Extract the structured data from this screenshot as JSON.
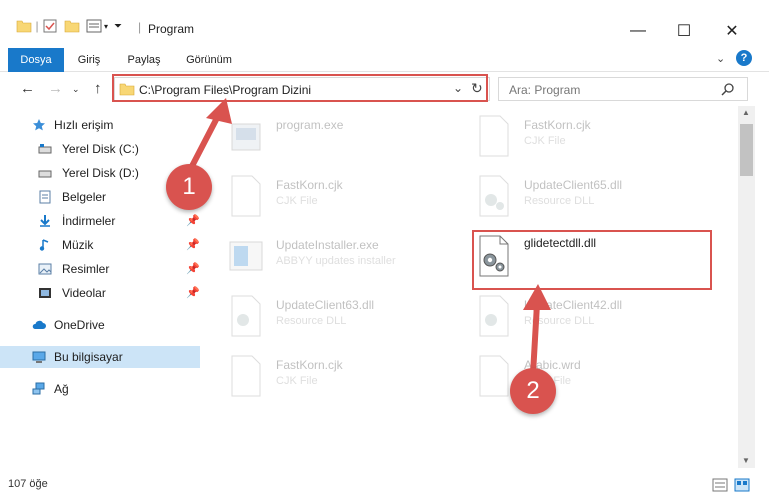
{
  "window": {
    "title": "Program",
    "minimize": "—",
    "maximize": "☐",
    "close": "✕"
  },
  "ribbon": {
    "tabs": [
      "Dosya",
      "Giriş",
      "Paylaş",
      "Görünüm"
    ],
    "help": "?"
  },
  "address": {
    "path": "C:\\Program Files\\Program Dizini",
    "search_placeholder": "Ara: Program"
  },
  "sidebar": {
    "quick_access": "Hızlı erişim",
    "items": [
      {
        "label": "Yerel Disk (C:)",
        "pinned": false
      },
      {
        "label": "Yerel Disk (D:)",
        "pinned": false
      },
      {
        "label": "Belgeler",
        "pinned": true
      },
      {
        "label": "İndirmeler",
        "pinned": true
      },
      {
        "label": "Müzik",
        "pinned": true
      },
      {
        "label": "Resimler",
        "pinned": true
      },
      {
        "label": "Videolar",
        "pinned": true
      }
    ],
    "onedrive": "OneDrive",
    "this_pc": "Bu bilgisayar",
    "network": "Ağ"
  },
  "files": [
    {
      "name": "program.exe",
      "type": ""
    },
    {
      "name": "FastKorn.cjk",
      "type": "CJK File"
    },
    {
      "name": "FastKorn.cjk",
      "type": "CJK File"
    },
    {
      "name": "UpdateClient65.dll",
      "type": "Resource DLL"
    },
    {
      "name": "UpdateInstaller.exe",
      "type": "ABBYY updates installer"
    },
    {
      "name": "glidetectdll.dll",
      "type": ""
    },
    {
      "name": "UpdateClient63.dll",
      "type": "Resource DLL"
    },
    {
      "name": "UpdateClient42.dll",
      "type": "Resource DLL"
    },
    {
      "name": "FastKorn.cjk",
      "type": "CJK File"
    },
    {
      "name": "Arabic.wrd",
      "type": "WRD File"
    }
  ],
  "status": {
    "count": "107 öğe"
  },
  "annotations": {
    "step1": "1",
    "step2": "2",
    "color": "#d9534f"
  }
}
